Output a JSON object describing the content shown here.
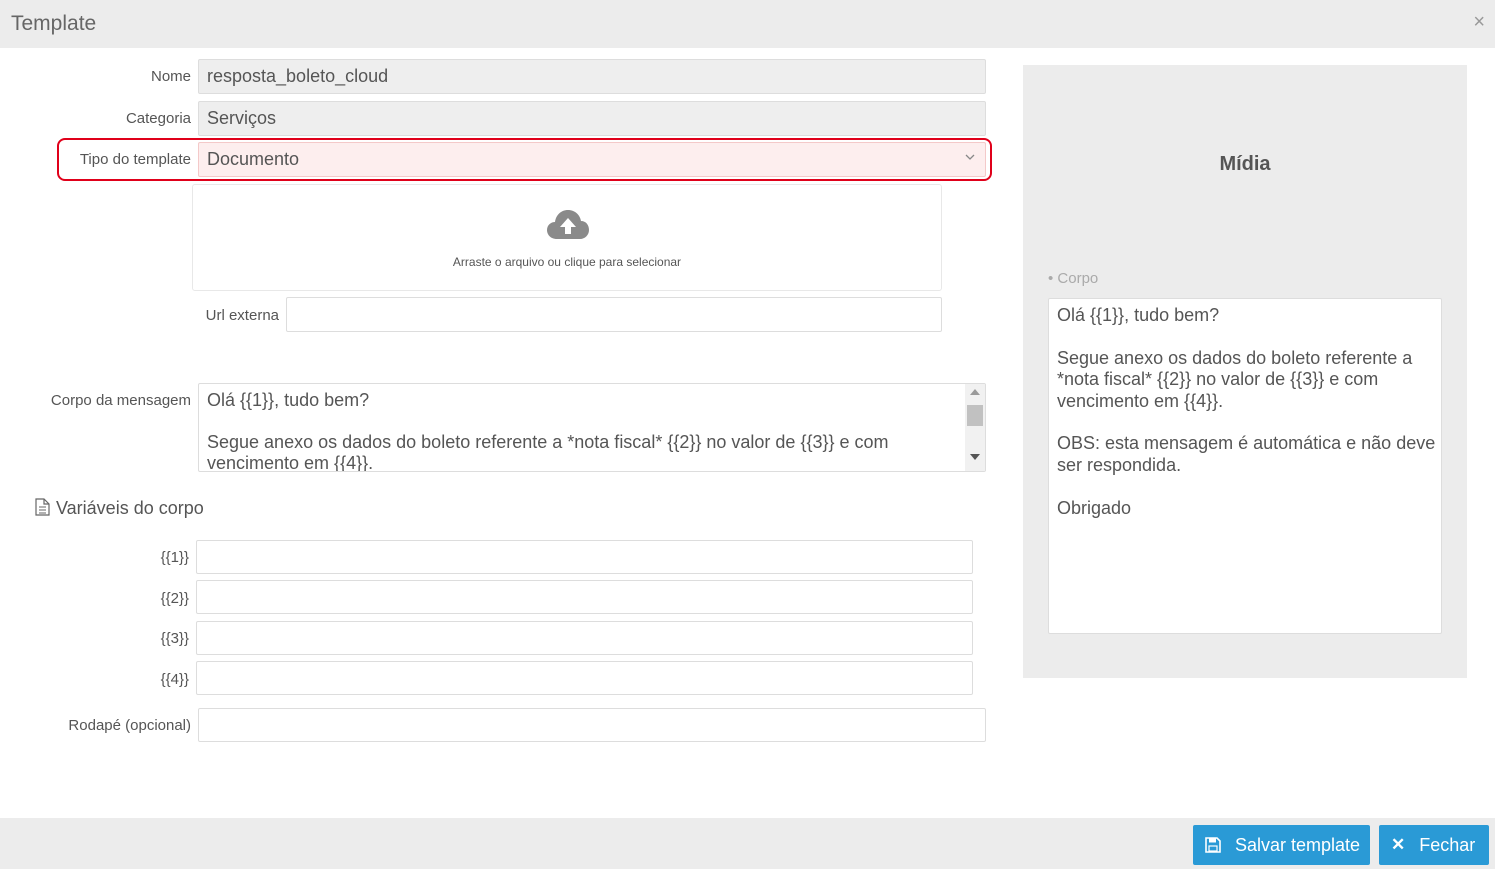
{
  "header": {
    "title": "Template",
    "close_glyph": "×"
  },
  "form": {
    "nome": {
      "label": "Nome",
      "value": "resposta_boleto_cloud"
    },
    "categoria": {
      "label": "Categoria",
      "value": "Serviços"
    },
    "tipo": {
      "label": "Tipo do template",
      "value": "Documento"
    },
    "dropzone": {
      "icon": "cloud-upload-icon",
      "text": "Arraste o arquivo ou clique para selecionar"
    },
    "url_externa": {
      "label": "Url externa",
      "value": ""
    },
    "corpo": {
      "label": "Corpo da mensagem",
      "value": "Olá {{1}}, tudo bem?\n\nSegue anexo os dados do boleto referente a *nota fiscal* {{2}} no valor de {{3}} e com vencimento em {{4}}.\n\nOBS: esta mensagem é automática e não deve ser respondida.\n\nObrigado"
    },
    "variaveis": {
      "title": "Variáveis do corpo",
      "items": [
        {
          "label": "{{1}}",
          "value": ""
        },
        {
          "label": "{{2}}",
          "value": ""
        },
        {
          "label": "{{3}}",
          "value": ""
        },
        {
          "label": "{{4}}",
          "value": ""
        }
      ]
    },
    "rodape": {
      "label": "Rodapé (opcional)",
      "value": ""
    }
  },
  "preview": {
    "title": "Mídia",
    "corpo_label": "• Corpo",
    "text": "Olá {{1}}, tudo bem?\n\nSegue anexo os dados do boleto referente a *nota fiscal* {{2}} no valor de {{3}} e com vencimento em {{4}}.\n\nOBS: esta mensagem é automática e não deve ser respondida.\n\nObrigado"
  },
  "footer": {
    "save_label": "Salvar template",
    "close_label": "Fechar",
    "close_glyph": "✕"
  },
  "colors": {
    "accent": "#2a9ad6",
    "highlight": "#e0001a",
    "panel_bg": "#ececec"
  }
}
